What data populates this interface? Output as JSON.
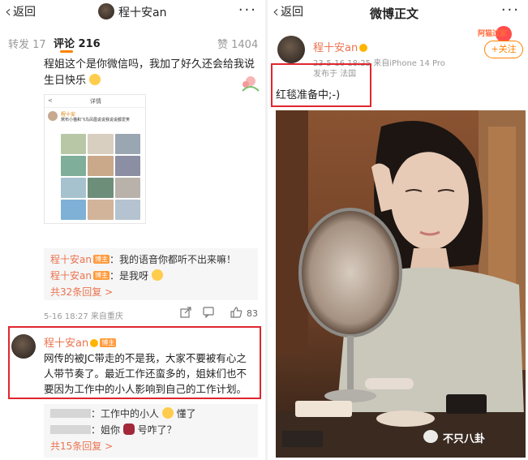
{
  "left": {
    "nav": {
      "back_label": "返回",
      "user_name": "程十安an",
      "more": "···"
    },
    "tabs": {
      "repost": "转发 17",
      "comment": "评论 216",
      "like": "赞 1404"
    },
    "comment": {
      "text": "程姐这个是你微信吗，我加了好久还会给我说生日快乐"
    },
    "embed": {
      "back": "<",
      "title": "详情",
      "name": "程十安",
      "text": "窝布小猫和飞鸟凤凰说说我说说都爱笑"
    },
    "replies": [
      {
        "name": "程十安an",
        "badge": "博主",
        "text": "：我的语音你都听不出来嘛！"
      },
      {
        "name": "程十安an",
        "badge": "博主",
        "text": "：是我呀"
      }
    ],
    "replies_more": "共32条回复 >",
    "meta": "5-16 18:27  来自重庆",
    "like_count": "83",
    "highlight": {
      "name": "程十安an",
      "badge": "博主",
      "text": "网传的被JC带走的不是我，大家不要被有心之人带节奏了。最近工作还蛮多的，姐妹们也不要因为工作中的小人影响到自己的工作计划。"
    },
    "sub_replies": [
      {
        "text": "：工作中的小人",
        "suffix": "懂了"
      },
      {
        "text": "：姐你",
        "suffix": "号咋了？"
      }
    ],
    "sub_more": "共15条回复 >"
  },
  "right": {
    "nav": {
      "back_label": "返回",
      "title": "微博正文",
      "more": "···"
    },
    "post": {
      "name": "程十安an",
      "meta": "23-5-16 18:25  来自iPhone 14 Pro",
      "location": "发布于 法国",
      "text": "红毯准备中;-)",
      "follow": "+关注",
      "deco": "阿猫过家"
    },
    "watermark": "不只八卦"
  },
  "colors": {
    "accent": "#ff8200",
    "highlight_border": "#e0262e",
    "name": "#eb7350"
  }
}
